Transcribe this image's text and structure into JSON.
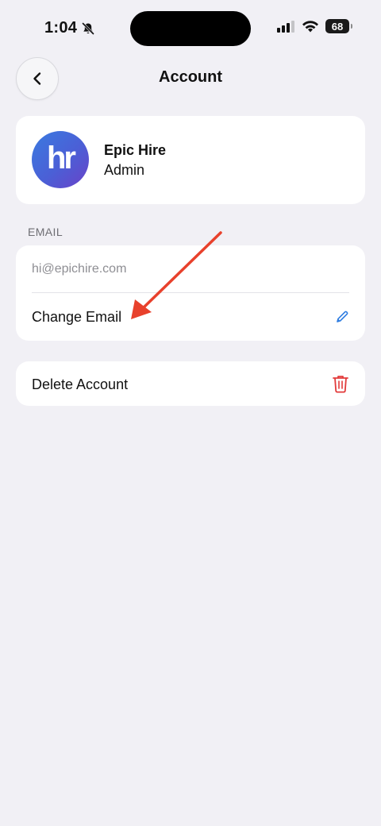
{
  "status_bar": {
    "time": "1:04",
    "battery": "68",
    "icons": [
      "bell-slash-icon",
      "cellular-signal-icon",
      "wifi-icon",
      "battery-icon"
    ]
  },
  "nav": {
    "title": "Account",
    "back_icon": "chevron-left-icon"
  },
  "profile": {
    "name": "Epic Hire",
    "role": "Admin",
    "avatar_text": "hr"
  },
  "email_section": {
    "label": "EMAIL",
    "value": "hi@epichire.com",
    "change_label": "Change Email",
    "change_icon": "pencil-icon"
  },
  "delete": {
    "label": "Delete Account",
    "icon": "trash-icon"
  },
  "colors": {
    "background": "#f1f0f5",
    "card": "#ffffff",
    "accent_blue": "#2f7de1",
    "danger_red": "#e23b3b",
    "annotation_arrow": "#e8412c"
  }
}
